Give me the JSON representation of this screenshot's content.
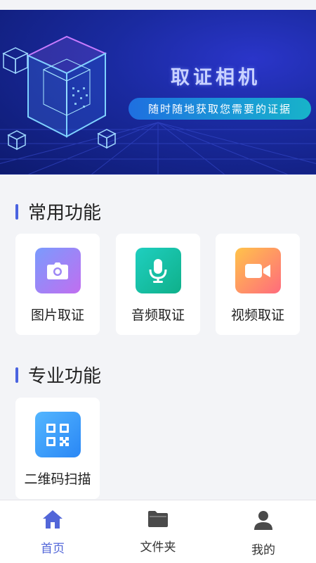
{
  "banner": {
    "title": "取证相机",
    "subtitle": "随时随地获取您需要的证据"
  },
  "sections": {
    "common": {
      "title": "常用功能",
      "items": [
        {
          "label": "图片取证",
          "icon": "camera-icon"
        },
        {
          "label": "音频取证",
          "icon": "microphone-icon"
        },
        {
          "label": "视频取证",
          "icon": "video-camera-icon"
        }
      ]
    },
    "pro": {
      "title": "专业功能",
      "items": [
        {
          "label": "二维码扫描",
          "icon": "qr-code-icon"
        }
      ]
    }
  },
  "tabbar": {
    "items": [
      {
        "label": "首页",
        "icon": "home-icon",
        "active": true
      },
      {
        "label": "文件夹",
        "icon": "folder-icon",
        "active": false
      },
      {
        "label": "我的",
        "icon": "user-icon",
        "active": false
      }
    ]
  },
  "colors": {
    "accent": "#5266d8",
    "section_bar": "#4a63e0",
    "background": "#f3f4f7"
  }
}
